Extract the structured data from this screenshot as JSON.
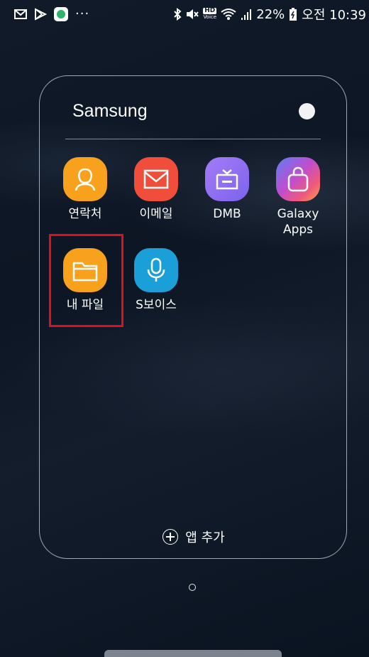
{
  "statusbar": {
    "battery_percent": "22%",
    "time": "오전 10:39",
    "overflow": "···",
    "hd_voice_top": "HD",
    "hd_voice_bottom": "Voice"
  },
  "folder": {
    "title": "Samsung",
    "apps": [
      {
        "label": "연락처",
        "icon": "contacts-icon",
        "color": "#f7a11c"
      },
      {
        "label": "이메일",
        "icon": "email-icon",
        "color": "#f04e3a"
      },
      {
        "label": "DMB",
        "icon": "dmb-icon",
        "color": "#8b6cf0"
      },
      {
        "label": "Galaxy\nApps",
        "icon": "galaxy-apps-icon",
        "color": "#e0489a"
      },
      {
        "label": "내 파일",
        "icon": "my-files-icon",
        "color": "#f7a11c"
      },
      {
        "label": "S보이스",
        "icon": "s-voice-icon",
        "color": "#1a9fd8"
      }
    ],
    "add_app_label": "앱 추가"
  },
  "colors": {
    "highlight": "#e0101a",
    "background": "#101a28"
  }
}
